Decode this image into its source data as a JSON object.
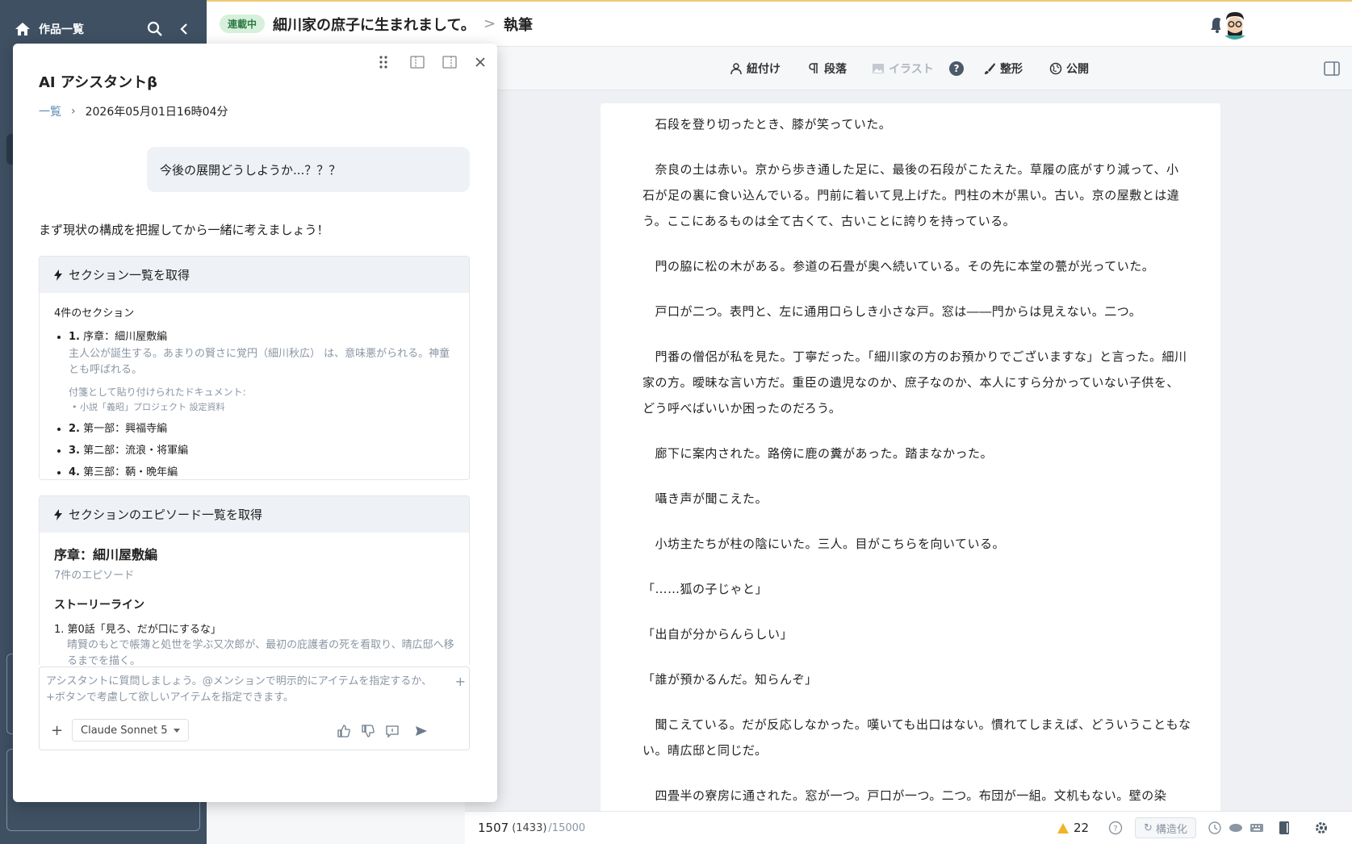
{
  "sidebar": {
    "works_label": "作品一覧"
  },
  "header": {
    "status_badge": "連載中",
    "work_title": "細川家の庶子に生まれまして。",
    "separator": ">",
    "page": "執筆"
  },
  "toolbar": {
    "tie": "紐付け",
    "paragraph": "段落",
    "illustration": "イラスト",
    "help": "?",
    "format": "整形",
    "publish": "公開"
  },
  "editor": {
    "paragraphs": [
      "　石段を登り切ったとき、膝が笑っていた。",
      "　奈良の土は赤い。京から歩き通した足に、最後の石段がこたえた。草履の底がすり減って、小石が足の裏に食い込んでいる。門前に着いて見上げた。門柱の木が黒い。古い。京の屋敷とは違う。ここにあるものは全て古くて、古いことに誇りを持っている。",
      "　門の脇に松の木がある。参道の石畳が奥へ続いている。その先に本堂の甍が光っていた。",
      "　戸口が二つ。表門と、左に通用口らしき小さな戸。窓は――門からは見えない。二つ。",
      "　門番の僧侶が私を見た。丁寧だった。「細川家の方のお預かりでございますな」と言った。細川家の方。曖昧な言い方だ。重臣の遺児なのか、庶子なのか、本人にすら分かっていない子供を、どう呼べばいいか困ったのだろう。",
      "　廊下に案内された。路傍に鹿の糞があった。踏まなかった。",
      "　囁き声が聞こえた。",
      "　小坊主たちが柱の陰にいた。三人。目がこちらを向いている。",
      "「……狐の子じゃと」",
      "「出自が分からんらしい」",
      "「誰が預かるんだ。知らんぞ」",
      "　聞こえている。だが反応しなかった。嘆いても出口はない。慣れてしまえば、どういうこともない。晴広邸と同じだ。",
      "　四畳半の寮房に通された。窓が一つ。戸口が一つ。二つ。布団が一組。文机もない。壁の染"
    ]
  },
  "status": {
    "chars": "1507",
    "chars_paren": "(1433)",
    "chars_max": "/15000",
    "warnings": "22",
    "structure_label": "構造化"
  },
  "ai": {
    "title": "AI アシスタントβ",
    "crumb_link": "一覧",
    "crumb_sep": "›",
    "crumb_date": "2026年05月01日16時04分",
    "user_message": "今後の展開どうしようか...？？？",
    "reply": "まず現状の構成を把握してから一緒に考えましょう！",
    "tool1": {
      "title": "セクション一覧を取得",
      "count": "4件のセクション",
      "sections": [
        {
          "num": "1.",
          "name": "序章：細川屋敷編",
          "desc": "主人公が誕生する。あまりの賢さに覚円（細川秋広） は、意味悪がられる。神童とも呼ばれる。",
          "att_title": "付箋として貼り付けられたドキュメント:",
          "att_item": "• 小説「義昭」プロジェクト 設定資料"
        },
        {
          "num": "2.",
          "name": "第一部：興福寺編"
        },
        {
          "num": "3.",
          "name": "第二部：流浪・将軍編"
        },
        {
          "num": "4.",
          "name": "第三部：鞆・晩年編"
        }
      ]
    },
    "tool2": {
      "title": "セクションのエピソード一覧を取得",
      "section_title": "序章：細川屋敷編",
      "episode_count": "7件のエピソード",
      "storyline_label": "ストーリーライン",
      "episodes": [
        {
          "label": "1. 第0話「見ろ、だが口にするな」",
          "desc": "晴賢のもとで帳簿と処世を学ぶ又次郎が、最初の庇護者の死を看取り、晴広邸へ移るまでを描く。"
        }
      ]
    },
    "input": {
      "placeholder": "アシスタントに質問しましょう。@メンションで明示的にアイテムを指定するか、+ボタンで考慮して欲しいアイテムを指定できます。",
      "model": "Claude Sonnet 5"
    }
  },
  "colors": {
    "sidebar": "#3e5062",
    "badge_bg": "#d6f0dc",
    "link": "#5a8bb3",
    "warning": "#f0b429"
  }
}
